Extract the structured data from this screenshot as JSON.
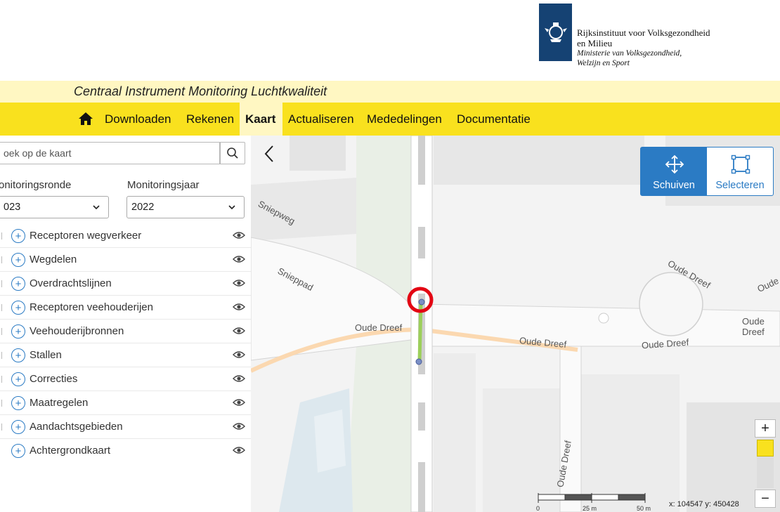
{
  "logo": {
    "line1": "Rijksinstituut voor Volksgezondheid",
    "line2": "en Milieu",
    "line3": "Ministerie van Volksgezondheid,",
    "line4": "Welzijn en Sport"
  },
  "app_title": "Centraal Instrument Monitoring Luchtkwaliteit",
  "nav": {
    "items": [
      {
        "label": "Downloaden"
      },
      {
        "label": "Rekenen"
      },
      {
        "label": "Kaart",
        "active": true
      },
      {
        "label": "Actualiseren"
      },
      {
        "label": "Mededelingen"
      },
      {
        "label": "Documentatie"
      }
    ],
    "home_icon": "home-icon"
  },
  "sidebar": {
    "search_placeholder": "oek op de kaart",
    "monitoringsronde_label": "onitoringsronde",
    "monitoringsronde_value": "023",
    "monitoringsjaar_label": "Monitoringsjaar",
    "monitoringsjaar_value": "2022",
    "layers": [
      {
        "label": "Receptoren wegverkeer"
      },
      {
        "label": "Wegdelen"
      },
      {
        "label": "Overdrachtslijnen"
      },
      {
        "label": "Receptoren veehouderijen"
      },
      {
        "label": "Veehouderijbronnen"
      },
      {
        "label": "Stallen"
      },
      {
        "label": "Correcties"
      },
      {
        "label": "Maatregelen"
      },
      {
        "label": "Aandachtsgebieden"
      },
      {
        "label": "Achtergrondkaart"
      }
    ]
  },
  "map": {
    "streets": [
      "Sniepweg",
      "Snieppad",
      "Oude Dreef",
      "Oude Dreef",
      "Oude Dreef",
      "Oude Dreef",
      "Oude Dreef",
      "Oude",
      "Oude Dreef"
    ],
    "tools": {
      "move_label": "Schuiven",
      "select_label": "Selecteren"
    },
    "zoom_in": "+",
    "zoom_out": "−",
    "scale_labels": [
      "0",
      "25 m",
      "50 m"
    ],
    "coordinates": "x: 104547 y: 450428",
    "colors": {
      "accent": "#2b7bc4",
      "nav_yellow": "#f9e11e",
      "highlight_circle": "#e30613",
      "road_line": "#9ccf5a",
      "main_road": "#fbd8b0"
    }
  }
}
